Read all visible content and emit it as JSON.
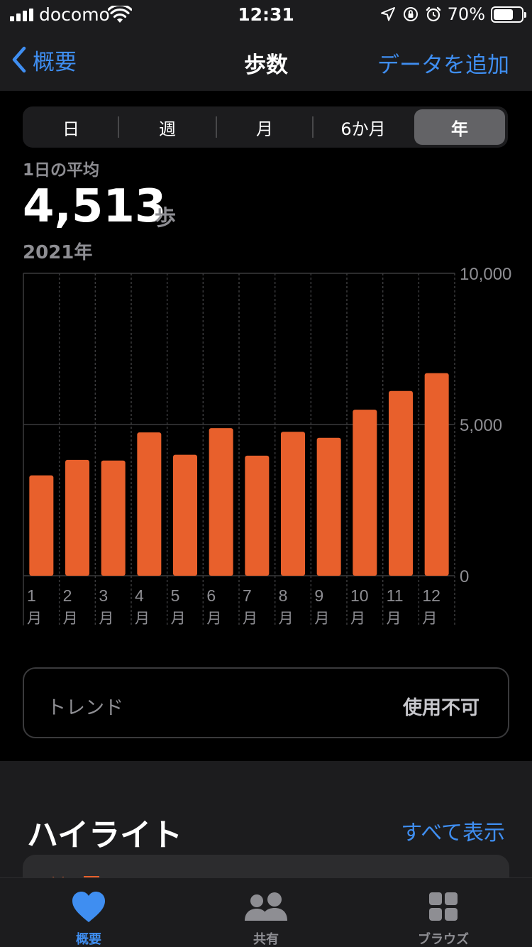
{
  "status_bar": {
    "carrier": "docomo",
    "time": "12:31",
    "battery_percent": "70%",
    "battery_level": 0.7,
    "icons": [
      "signal-icon",
      "wifi-icon",
      "location-icon",
      "orientation-lock-icon",
      "alarm-icon",
      "battery-icon"
    ]
  },
  "nav": {
    "back_label": "概要",
    "title": "歩数",
    "action_label": "データを追加"
  },
  "segments": {
    "items": [
      "日",
      "週",
      "月",
      "6か月",
      "年"
    ],
    "selected": "年"
  },
  "summary": {
    "label": "1日の平均",
    "value": "4,513",
    "unit": "歩",
    "period": "2021年"
  },
  "chart_data": {
    "type": "bar",
    "categories": [
      "1月",
      "2月",
      "3月",
      "4月",
      "5月",
      "6月",
      "7月",
      "8月",
      "9月",
      "10月",
      "11月",
      "12月"
    ],
    "category_lines": [
      [
        "1",
        "月"
      ],
      [
        "2",
        "月"
      ],
      [
        "3",
        "月"
      ],
      [
        "4",
        "月"
      ],
      [
        "5",
        "月"
      ],
      [
        "6",
        "月"
      ],
      [
        "7",
        "月"
      ],
      [
        "8",
        "月"
      ],
      [
        "9",
        "月"
      ],
      [
        "10",
        "月"
      ],
      [
        "11",
        "月"
      ],
      [
        "12",
        "月"
      ]
    ],
    "values": [
      3320,
      3830,
      3810,
      4740,
      4000,
      4880,
      3970,
      4760,
      4560,
      5490,
      6110,
      6700
    ],
    "ylim": [
      0,
      10000
    ],
    "yticks": [
      0,
      5000,
      10000
    ],
    "ytick_labels": [
      "0",
      "5,000",
      "10,000"
    ],
    "bar_color": "#e8602c",
    "grid": true
  },
  "trend": {
    "label": "トレンド",
    "value": "使用不可"
  },
  "highlights": {
    "title": "ハイライト",
    "link": "すべて表示"
  },
  "tabbar": {
    "items": [
      {
        "label": "概要",
        "icon": "heart-icon",
        "active": true
      },
      {
        "label": "共有",
        "icon": "people-icon",
        "active": false
      },
      {
        "label": "ブラウズ",
        "icon": "grid-icon",
        "active": false
      }
    ]
  },
  "colors": {
    "accent": "#3f8ef1",
    "bar": "#e8602c",
    "secondary_text": "#8e8e93"
  }
}
